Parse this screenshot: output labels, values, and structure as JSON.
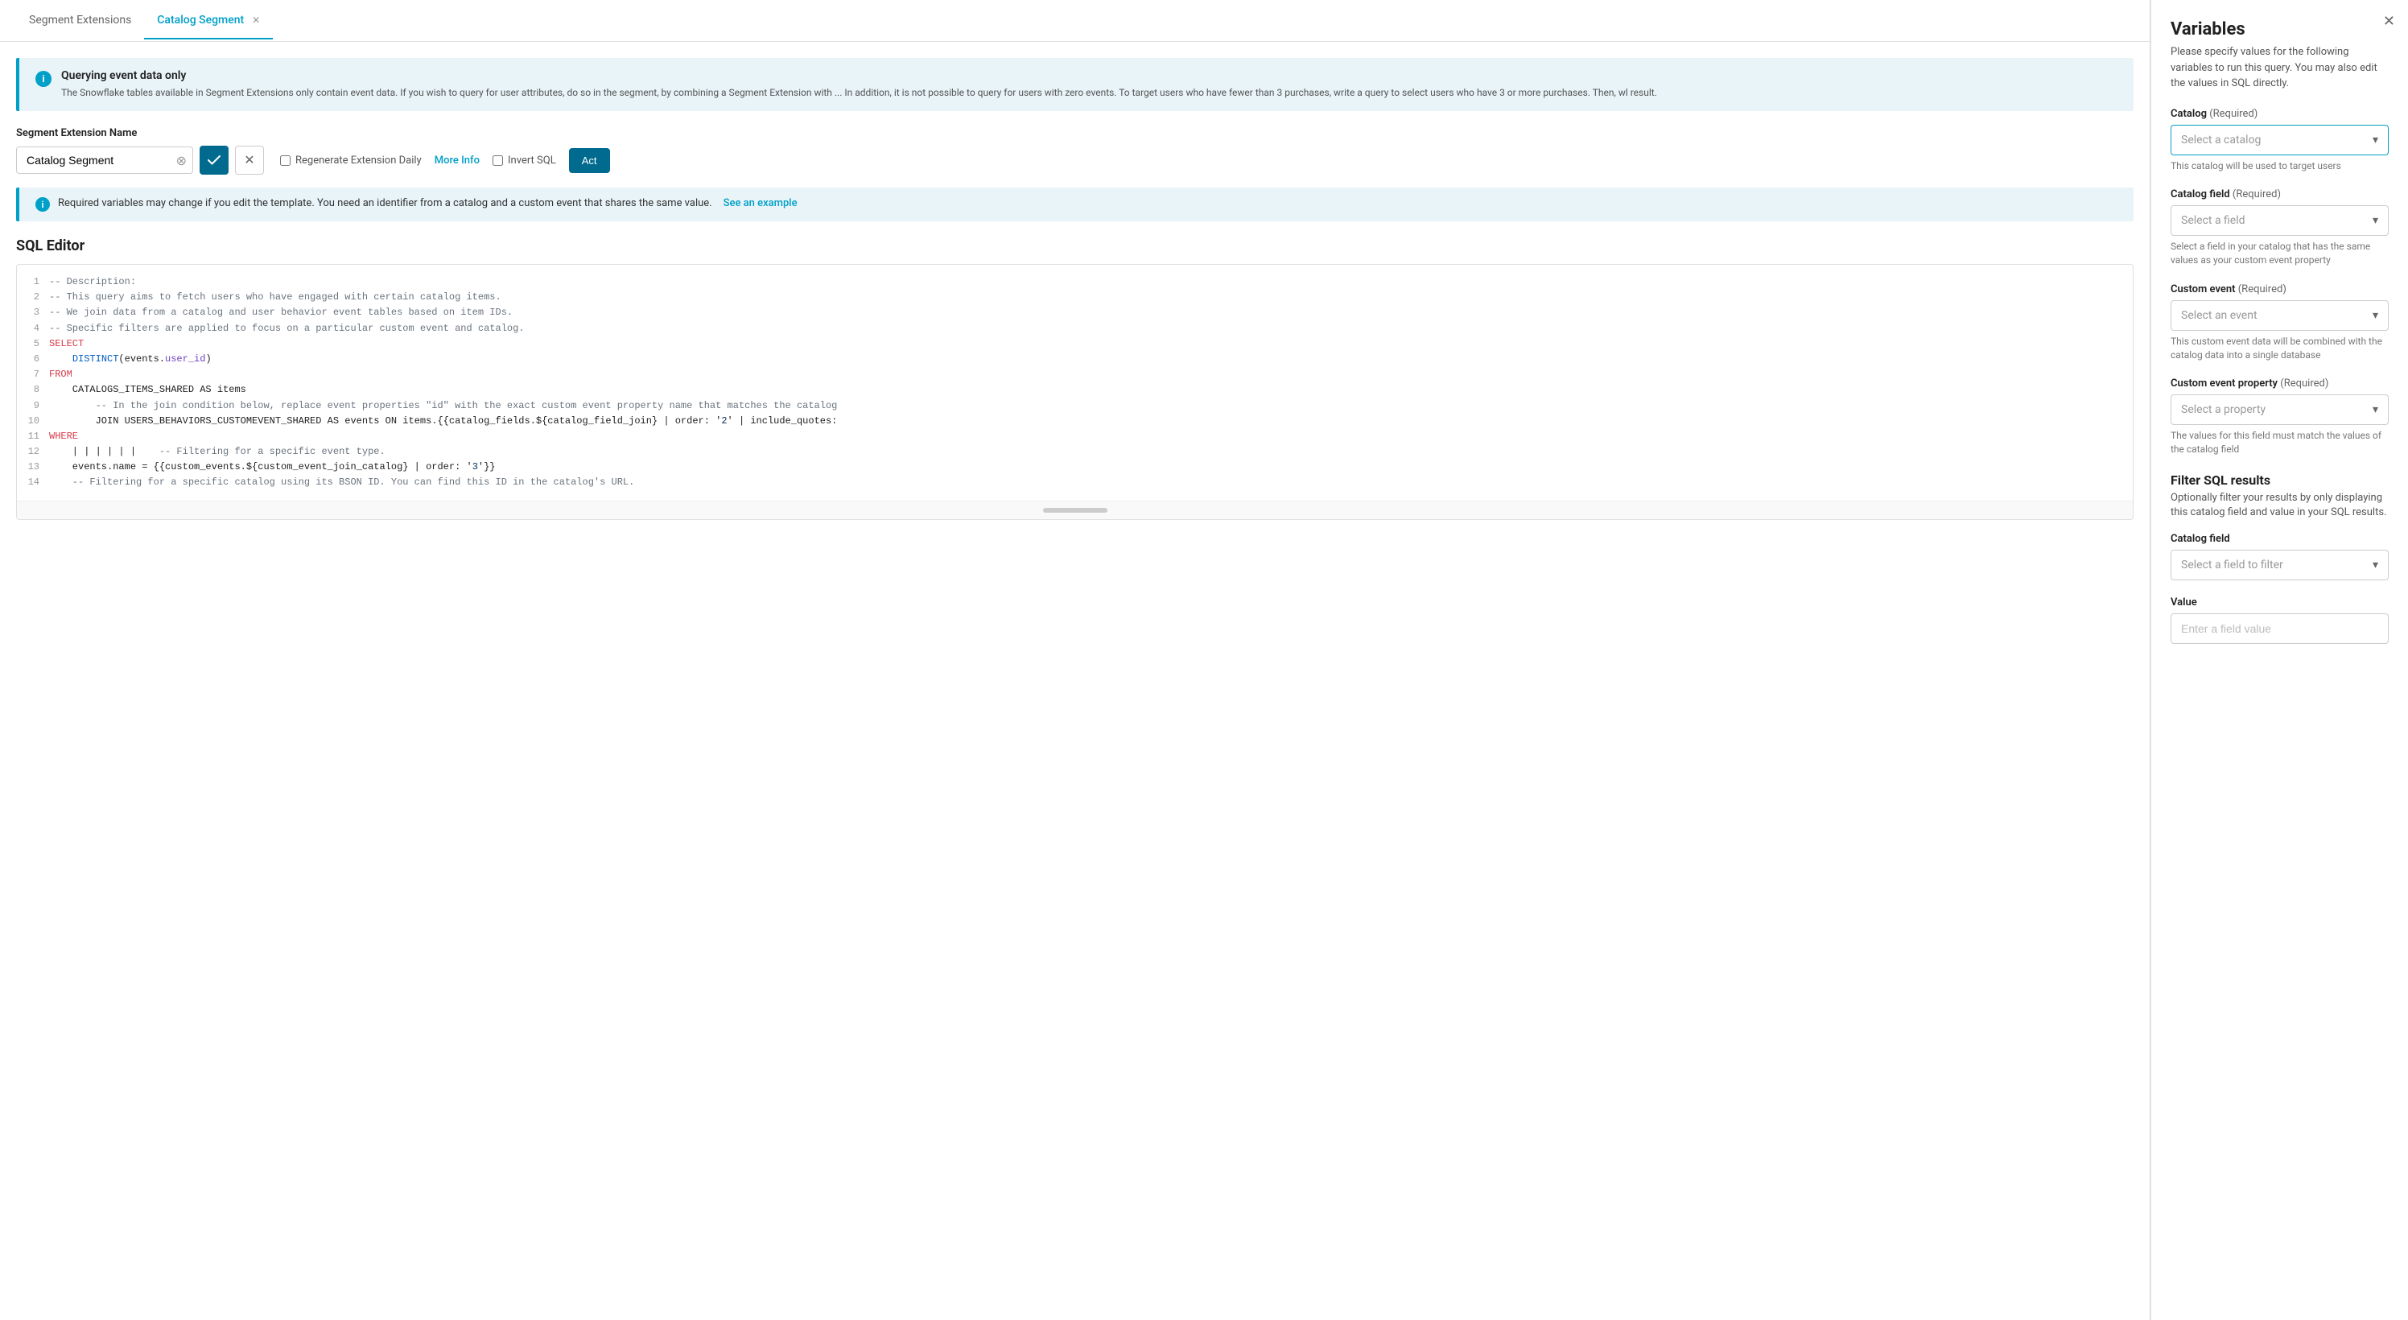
{
  "tabs": [
    {
      "id": "segment-extensions",
      "label": "Segment Extensions",
      "active": false
    },
    {
      "id": "catalog-segment",
      "label": "Catalog Segment",
      "active": true,
      "closeable": true
    }
  ],
  "info_banner": {
    "title": "Querying event data only",
    "body": "The Snowflake tables available in Segment Extensions only contain event data. If you wish to query for user attributes, do so in the segment, by combining a Segment Extension with ... In addition, it is not possible to query for users with zero events. To target users who have fewer than 3 purchases, write a query to select users who have 3 or more purchases. Then, wl result."
  },
  "name_section": {
    "label": "Segment Extension Name",
    "value": "Catalog Segment",
    "confirm_label": "✓",
    "cancel_label": "✕"
  },
  "options": {
    "regenerate_label": "Regenerate Extension Daily",
    "more_info_label": "More Info",
    "invert_sql_label": "Invert SQL",
    "act_label": "Act"
  },
  "req_banner": {
    "text": "Required variables may change if you edit the template. You need an identifier from a catalog and a custom event that shares the same value.",
    "link_label": "See an example"
  },
  "sql_editor": {
    "title": "SQL Editor",
    "lines": [
      {
        "num": 1,
        "tokens": [
          {
            "t": "comment",
            "v": "-- Description:"
          }
        ]
      },
      {
        "num": 2,
        "tokens": [
          {
            "t": "comment",
            "v": "-- This query aims to fetch users who have engaged with certain catalog items."
          }
        ]
      },
      {
        "num": 3,
        "tokens": [
          {
            "t": "comment",
            "v": "-- We join data from a catalog and user behavior event tables based on item IDs."
          }
        ]
      },
      {
        "num": 4,
        "tokens": [
          {
            "t": "comment",
            "v": "-- Specific filters are applied to focus on a particular custom event and catalog."
          }
        ]
      },
      {
        "num": 5,
        "tokens": [
          {
            "t": "keyword",
            "v": "SELECT"
          }
        ]
      },
      {
        "num": 6,
        "tokens": [
          {
            "t": "spaces",
            "v": "    "
          },
          {
            "t": "func",
            "v": "DISTINCT"
          },
          {
            "t": "normal",
            "v": "(events."
          },
          {
            "t": "identifier",
            "v": "user_id"
          },
          {
            "t": "normal",
            "v": ")"
          }
        ]
      },
      {
        "num": 7,
        "tokens": [
          {
            "t": "keyword",
            "v": "FROM"
          }
        ]
      },
      {
        "num": 8,
        "tokens": [
          {
            "t": "spaces",
            "v": "    "
          },
          {
            "t": "normal",
            "v": "CATALOGS_ITEMS_SHARED AS items"
          }
        ]
      },
      {
        "num": 9,
        "tokens": [
          {
            "t": "spaces",
            "v": "        "
          },
          {
            "t": "comment",
            "v": "-- In the join condition below, replace event properties \"id\" with the exact custom event property name that matches the catalog"
          }
        ]
      },
      {
        "num": 10,
        "tokens": [
          {
            "t": "spaces",
            "v": "        "
          },
          {
            "t": "normal",
            "v": "JOIN USERS_BEHAVIORS_CUSTOMEVENT_SHARED AS events ON items.{{catalog_fields.${catalog_field_join} | order: '2' | include_quotes:"
          }
        ]
      },
      {
        "num": 11,
        "tokens": [
          {
            "t": "keyword",
            "v": "WHERE"
          }
        ]
      },
      {
        "num": 12,
        "tokens": [
          {
            "t": "spaces",
            "v": "    "
          },
          {
            "t": "normal",
            "v": "| | | | | |    "
          },
          {
            "t": "comment",
            "v": "-- Filtering for a specific event type."
          }
        ]
      },
      {
        "num": 13,
        "tokens": [
          {
            "t": "spaces",
            "v": "    "
          },
          {
            "t": "normal",
            "v": "events.name = {{custom_events.${custom_event_join_catalog} | order: '3'}}"
          }
        ]
      },
      {
        "num": 14,
        "tokens": [
          {
            "t": "spaces",
            "v": "    "
          },
          {
            "t": "comment",
            "v": "-- Filtering for a specific catalog using its BSON ID. You can find this ID in the catalog's URL."
          }
        ]
      }
    ]
  },
  "right_panel": {
    "title": "Variables",
    "subtitle": "Please specify values for the following variables to run this query. You may also edit the values in SQL directly.",
    "catalog_field": {
      "label": "Catalog",
      "required_label": "(Required)",
      "placeholder": "Select a catalog",
      "hint": "This catalog will be used to target users"
    },
    "catalog_field2": {
      "label": "Catalog field",
      "required_label": "(Required)",
      "placeholder": "Select a field",
      "hint": "Select a field in your catalog that has the same values as your custom event property"
    },
    "custom_event": {
      "label": "Custom event",
      "required_label": "(Required)",
      "placeholder": "Select an event",
      "hint": "This custom event data will be combined with the catalog data into a single database"
    },
    "custom_event_property": {
      "label": "Custom event property",
      "required_label": "(Required)",
      "placeholder": "Select a property",
      "hint": "The values for this field must match the values of the catalog field"
    },
    "filter_section": {
      "title": "Filter SQL results",
      "subtitle": "Optionally filter your results by only displaying this catalog field and value in your SQL results."
    },
    "filter_field": {
      "label": "Catalog field",
      "placeholder": "Select a field to filter"
    },
    "filter_value": {
      "label": "Value",
      "placeholder": "Enter a field value"
    }
  }
}
